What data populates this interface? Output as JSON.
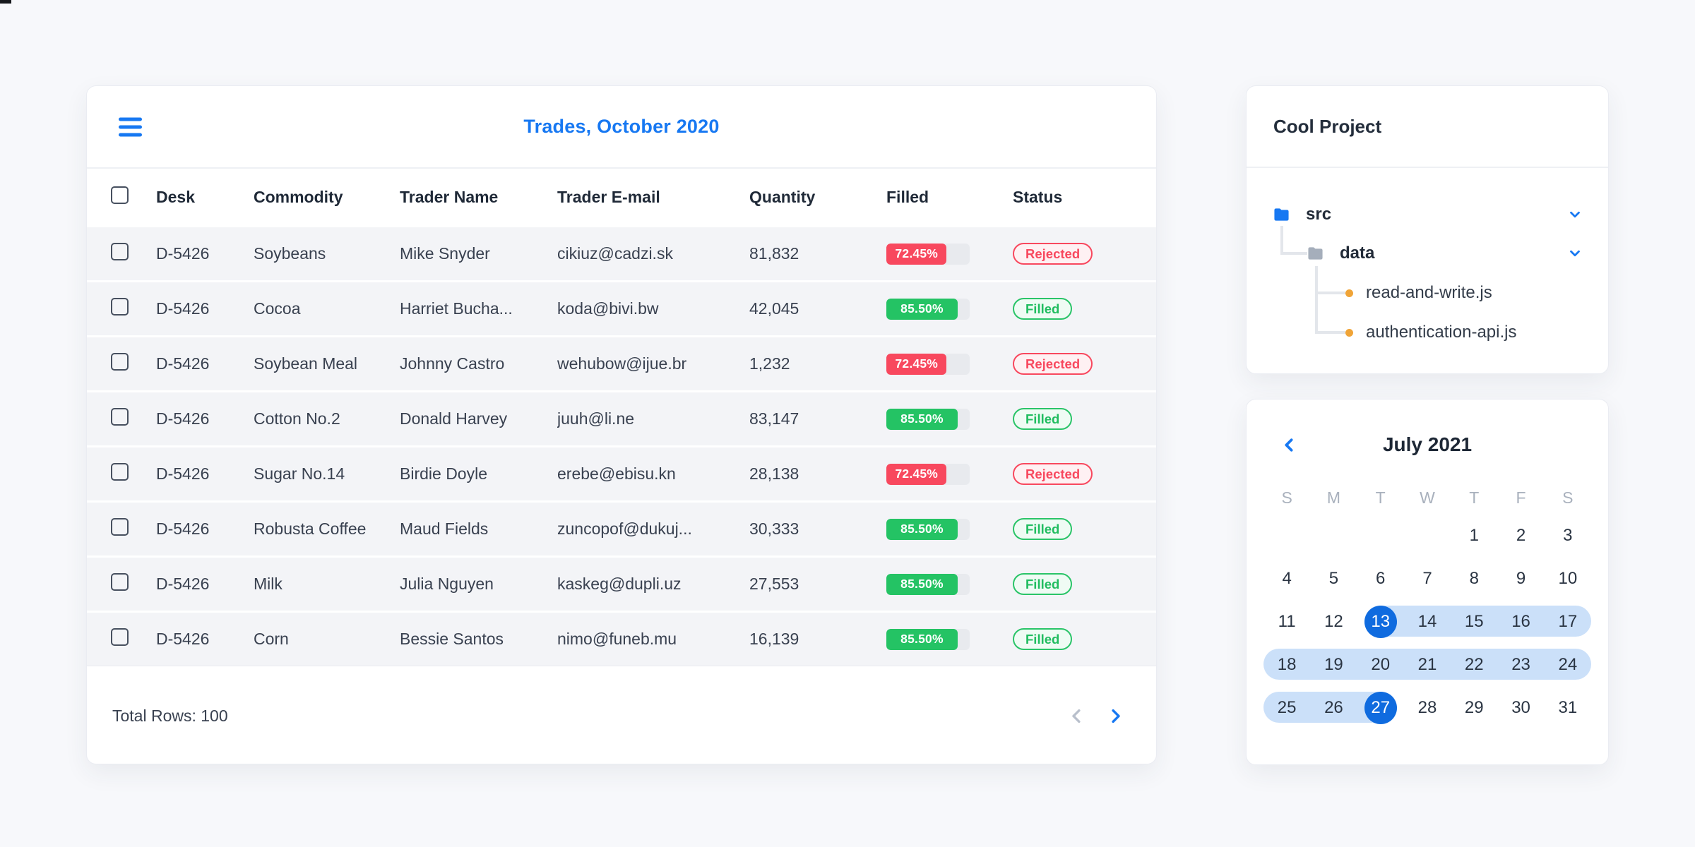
{
  "colors": {
    "accent_blue": "#1778f2",
    "selected_day_blue": "#0f6bdf",
    "range_light_blue": "#cbe0f9",
    "status_red": "#f8485e",
    "status_green": "#24c364",
    "page_background": "#f7f8fb"
  },
  "icons": {
    "menu": "hamburger-icon",
    "pager_prev": "chevron-left-icon",
    "pager_next": "chevron-right-icon",
    "tree_expand": "chevron-down-icon",
    "calendar_prev": "chevron-left-icon",
    "folder": "folder-icon",
    "file_bullet": "orange-dot-icon"
  },
  "trades_card": {
    "title": "Trades, October 2020",
    "columns": [
      "Desk",
      "Commodity",
      "Trader Name",
      "Trader E-mail",
      "Quantity",
      "Filled",
      "Status"
    ],
    "rows": [
      {
        "desk": "D-5426",
        "commodity": "Soybeans",
        "trader": "Mike Snyder",
        "email": "cikiuz@cadzi.sk",
        "quantity": "81,832",
        "filled": "72.45%",
        "filled_pct": 72.45,
        "status": "Rejected"
      },
      {
        "desk": "D-5426",
        "commodity": "Cocoa",
        "trader": "Harriet Bucha...",
        "email": "koda@bivi.bw",
        "quantity": "42,045",
        "filled": "85.50%",
        "filled_pct": 85.5,
        "status": "Filled"
      },
      {
        "desk": "D-5426",
        "commodity": "Soybean Meal",
        "trader": "Johnny Castro",
        "email": "wehubow@ijue.br",
        "quantity": "1,232",
        "filled": "72.45%",
        "filled_pct": 72.45,
        "status": "Rejected"
      },
      {
        "desk": "D-5426",
        "commodity": "Cotton No.2",
        "trader": "Donald Harvey",
        "email": "juuh@li.ne",
        "quantity": "83,147",
        "filled": "85.50%",
        "filled_pct": 85.5,
        "status": "Filled"
      },
      {
        "desk": "D-5426",
        "commodity": "Sugar No.14",
        "trader": "Birdie Doyle",
        "email": "erebe@ebisu.kn",
        "quantity": "28,138",
        "filled": "72.45%",
        "filled_pct": 72.45,
        "status": "Rejected"
      },
      {
        "desk": "D-5426",
        "commodity": "Robusta Coffee",
        "trader": "Maud Fields",
        "email": "zuncopof@dukuj...",
        "quantity": "30,333",
        "filled": "85.50%",
        "filled_pct": 85.5,
        "status": "Filled"
      },
      {
        "desk": "D-5426",
        "commodity": "Milk",
        "trader": "Julia Nguyen",
        "email": "kaskeg@dupli.uz",
        "quantity": "27,553",
        "filled": "85.50%",
        "filled_pct": 85.5,
        "status": "Filled"
      },
      {
        "desk": "D-5426",
        "commodity": "Corn",
        "trader": "Bessie Santos",
        "email": "nimo@funeb.mu",
        "quantity": "16,139",
        "filled": "85.50%",
        "filled_pct": 85.5,
        "status": "Filled"
      }
    ],
    "footer": {
      "total_rows_label": "Total Rows: 100"
    }
  },
  "project_card": {
    "title": "Cool Project",
    "tree": {
      "src_label": "src",
      "data_label": "data",
      "files": [
        {
          "name": "read-and-write.js"
        },
        {
          "name": "authentication-api.js"
        }
      ]
    }
  },
  "calendar_card": {
    "title": "July 2021",
    "weekdays": [
      "S",
      "M",
      "T",
      "W",
      "T",
      "F",
      "S"
    ],
    "weeks": [
      [
        "",
        "",
        "",
        "",
        "1",
        "2",
        "3"
      ],
      [
        "4",
        "5",
        "6",
        "7",
        "8",
        "9",
        "10"
      ],
      [
        "11",
        "12",
        "13",
        "14",
        "15",
        "16",
        "17"
      ],
      [
        "18",
        "19",
        "20",
        "21",
        "22",
        "23",
        "24"
      ],
      [
        "25",
        "26",
        "27",
        "28",
        "29",
        "30",
        "31"
      ]
    ],
    "range_start": 13,
    "range_end": 27
  }
}
